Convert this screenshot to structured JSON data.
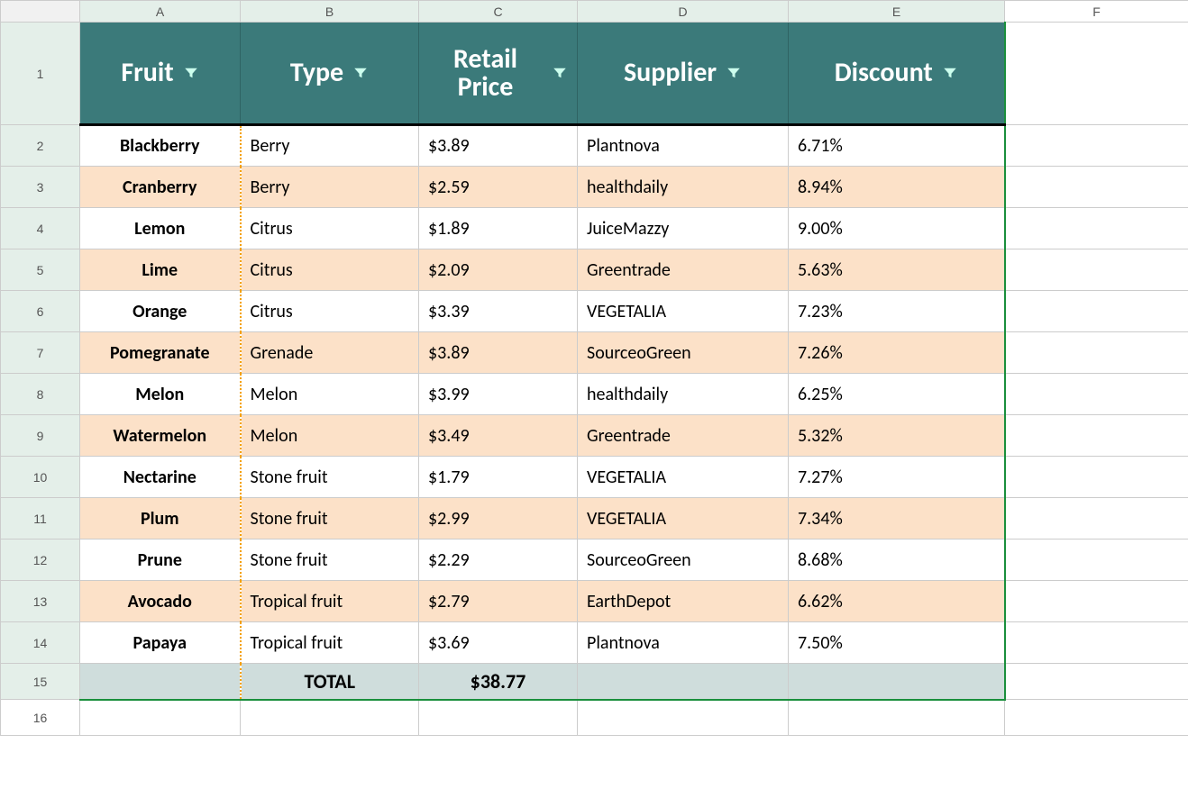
{
  "columns": [
    "A",
    "B",
    "C",
    "D",
    "E",
    "F"
  ],
  "headers": {
    "fruit": "Fruit",
    "type": "Type",
    "price": "Retail Price",
    "supplier": "Supplier",
    "discount": "Discount"
  },
  "rows": [
    {
      "fruit": "Blackberry",
      "type": "Berry",
      "price": "$3.89",
      "supplier": "Plantnova",
      "discount": "6.71%"
    },
    {
      "fruit": "Cranberry",
      "type": "Berry",
      "price": "$2.59",
      "supplier": "healthdaily",
      "discount": "8.94%"
    },
    {
      "fruit": "Lemon",
      "type": "Citrus",
      "price": "$1.89",
      "supplier": "JuiceMazzy",
      "discount": "9.00%"
    },
    {
      "fruit": "Lime",
      "type": "Citrus",
      "price": "$2.09",
      "supplier": "Greentrade",
      "discount": "5.63%"
    },
    {
      "fruit": "Orange",
      "type": "Citrus",
      "price": "$3.39",
      "supplier": "VEGETALIA",
      "discount": "7.23%"
    },
    {
      "fruit": "Pomegranate",
      "type": "Grenade",
      "price": "$3.89",
      "supplier": "SourceoGreen",
      "discount": "7.26%"
    },
    {
      "fruit": "Melon",
      "type": "Melon",
      "price": "$3.99",
      "supplier": "healthdaily",
      "discount": "6.25%"
    },
    {
      "fruit": "Watermelon",
      "type": "Melon",
      "price": "$3.49",
      "supplier": "Greentrade",
      "discount": "5.32%"
    },
    {
      "fruit": "Nectarine",
      "type": "Stone fruit",
      "price": "$1.79",
      "supplier": "VEGETALIA",
      "discount": "7.27%"
    },
    {
      "fruit": "Plum",
      "type": "Stone fruit",
      "price": "$2.99",
      "supplier": "VEGETALIA",
      "discount": "7.34%"
    },
    {
      "fruit": "Prune",
      "type": "Stone fruit",
      "price": "$2.29",
      "supplier": "SourceoGreen",
      "discount": "8.68%"
    },
    {
      "fruit": "Avocado",
      "type": "Tropical fruit",
      "price": "$2.79",
      "supplier": "EarthDepot",
      "discount": "6.62%"
    },
    {
      "fruit": "Papaya",
      "type": "Tropical fruit",
      "price": "$3.69",
      "supplier": "Plantnova",
      "discount": "7.50%"
    }
  ],
  "total": {
    "label": "TOTAL",
    "value": "$38.77"
  },
  "row_numbers": [
    "1",
    "2",
    "3",
    "4",
    "5",
    "6",
    "7",
    "8",
    "9",
    "10",
    "11",
    "12",
    "13",
    "14",
    "15",
    "16"
  ],
  "chart_data": {
    "type": "table",
    "columns": [
      "Fruit",
      "Type",
      "Retail Price",
      "Supplier",
      "Discount"
    ],
    "data": [
      [
        "Blackberry",
        "Berry",
        3.89,
        "Plantnova",
        0.0671
      ],
      [
        "Cranberry",
        "Berry",
        2.59,
        "healthdaily",
        0.0894
      ],
      [
        "Lemon",
        "Citrus",
        1.89,
        "JuiceMazzy",
        0.09
      ],
      [
        "Lime",
        "Citrus",
        2.09,
        "Greentrade",
        0.0563
      ],
      [
        "Orange",
        "Citrus",
        3.39,
        "VEGETALIA",
        0.0723
      ],
      [
        "Pomegranate",
        "Grenade",
        3.89,
        "SourceoGreen",
        0.0726
      ],
      [
        "Melon",
        "Melon",
        3.99,
        "healthdaily",
        0.0625
      ],
      [
        "Watermelon",
        "Melon",
        3.49,
        "Greentrade",
        0.0532
      ],
      [
        "Nectarine",
        "Stone fruit",
        1.79,
        "VEGETALIA",
        0.0727
      ],
      [
        "Plum",
        "Stone fruit",
        2.99,
        "VEGETALIA",
        0.0734
      ],
      [
        "Prune",
        "Stone fruit",
        2.29,
        "SourceoGreen",
        0.0868
      ],
      [
        "Avocado",
        "Tropical fruit",
        2.79,
        "EarthDepot",
        0.0662
      ],
      [
        "Papaya",
        "Tropical fruit",
        3.69,
        "Plantnova",
        0.075
      ]
    ],
    "total_retail_price": 38.77
  }
}
